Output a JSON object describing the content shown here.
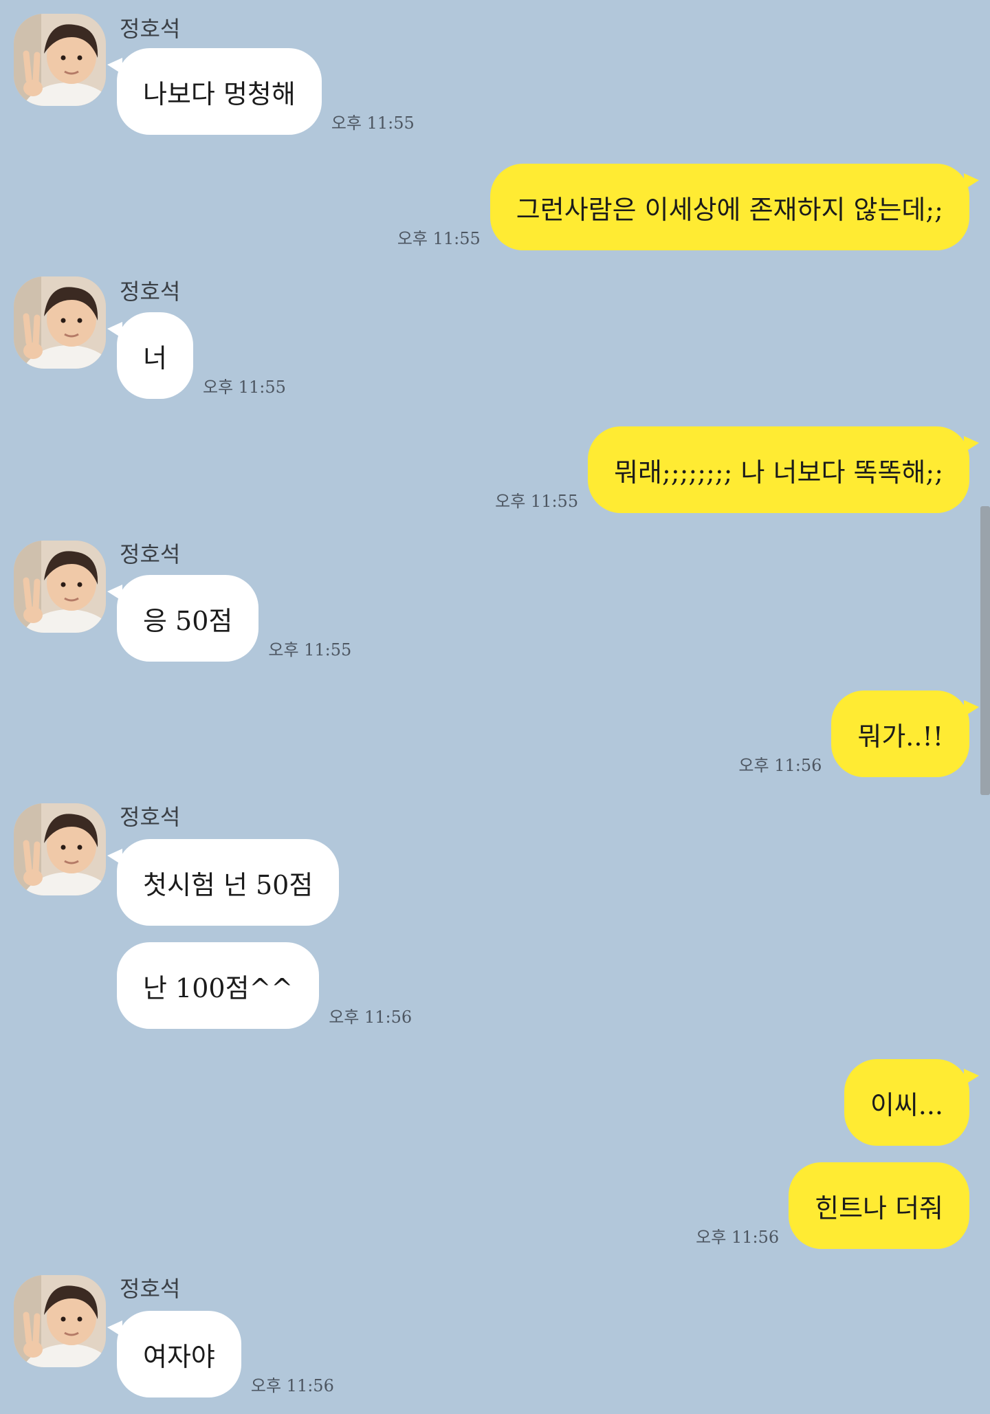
{
  "chat": {
    "other_name": "정호석",
    "messages": [
      {
        "text": "나보다 멍청해",
        "time": "오후 11:55"
      },
      {
        "text": "그런사람은 이세상에 존재하지 않는데;;",
        "time": "오후 11:55"
      },
      {
        "text": "너",
        "time": "오후 11:55"
      },
      {
        "text": "뭐래;;;;;;;; 나 너보다 똑똑해;;",
        "time": "오후 11:55"
      },
      {
        "text": "응 50점",
        "time": "오후 11:55"
      },
      {
        "text": "뭐가..!!",
        "time": "오후 11:56"
      },
      {
        "text": "첫시험 넌 50점",
        "time": ""
      },
      {
        "text": "난 100점^^",
        "time": "오후 11:56"
      },
      {
        "text": "이씨...",
        "time": ""
      },
      {
        "text": "힌트나 더줘",
        "time": "오후 11:56"
      },
      {
        "text": "여자야",
        "time": "오후 11:56"
      }
    ]
  },
  "colors": {
    "background": "#b2c7da",
    "my_bubble": "#ffeb33",
    "other_bubble": "#ffffff"
  },
  "icons": {
    "avatar": "profile-photo"
  }
}
